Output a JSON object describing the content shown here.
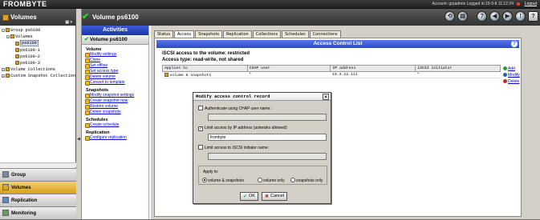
{
  "app": {
    "logo": "FROMBYTE",
    "account_text": "Account: grpadmin   Logged in:15-9-8 11:12:24",
    "logout_label": "Logout"
  },
  "left": {
    "title": "Volumes",
    "toolbar": "▣ ▾",
    "tree": [
      {
        "label": "Group ps6100",
        "level": 0,
        "expander": "−",
        "icon": "group"
      },
      {
        "label": "Volumes",
        "level": 1,
        "expander": "−",
        "icon": "folder"
      },
      {
        "label": "ps6100",
        "level": 2,
        "expander": "",
        "icon": "volume",
        "selected": true
      },
      {
        "label": "ps6100-1",
        "level": 2,
        "expander": "",
        "icon": "volume"
      },
      {
        "label": "ps6100-2",
        "level": 2,
        "expander": "",
        "icon": "volume"
      },
      {
        "label": "ps6100-3",
        "level": 2,
        "expander": "",
        "icon": "volume"
      },
      {
        "label": "Volume Collections",
        "level": 0,
        "expander": "+",
        "icon": "folder"
      },
      {
        "label": "Custom Snapshot Collections",
        "level": 0,
        "expander": "+",
        "icon": "folder"
      }
    ],
    "nav": [
      {
        "label": "Group",
        "active": false,
        "icon_color": "#7a8aa0"
      },
      {
        "label": "Volumes",
        "active": true,
        "icon_color": "#d6a42c"
      },
      {
        "label": "Replication",
        "active": false,
        "icon_color": "#5a8ac0"
      },
      {
        "label": "Monitoring",
        "active": false,
        "icon_color": "#6a9a6a"
      }
    ]
  },
  "main": {
    "title": "Volume ps6100",
    "header_icons": [
      "refresh-icon",
      "print-icon",
      "help-icon-round",
      "back-icon",
      "forward-icon",
      "alert-icon",
      "help-icon"
    ]
  },
  "activities": {
    "title": "Activities",
    "subtitle": "Volume ps6100",
    "sections": [
      {
        "heading": "Volume",
        "links": [
          "Modify settings",
          "Clone",
          "Set offline",
          "Set access type",
          "Delete volume",
          "Convert to template"
        ]
      },
      {
        "heading": "Snapshots",
        "links": [
          "Modify snapshot settings",
          "Create snapshot now",
          "Restore volume",
          "Delete snapshots"
        ]
      },
      {
        "heading": "Schedules",
        "links": [
          "Create schedule"
        ]
      },
      {
        "heading": "Replication",
        "links": [
          "Configure replication"
        ]
      }
    ]
  },
  "tabs": [
    "Status",
    "Access",
    "Snapshots",
    "Replication",
    "Collections",
    "Schedules",
    "Connections"
  ],
  "active_tab": "Access",
  "acl": {
    "title": "Access Control List",
    "help": "?",
    "iscsi_line": "iSCSI access to the volume: restricted",
    "access_type_line": "Access type: read-write, not shared",
    "columns": [
      "Applies to",
      "CHAP user",
      "IP address",
      "iSCSI initiator"
    ],
    "rows": [
      [
        "volume & snapshots",
        "*",
        "10.3.12.111",
        "*"
      ]
    ],
    "side_buttons": [
      {
        "label": "Add",
        "icon": "add-icon",
        "color": "#2aa02a"
      },
      {
        "label": "Modify",
        "icon": "modify-icon",
        "color": "#2a60c0"
      },
      {
        "label": "Delete",
        "icon": "delete-icon",
        "color": "#c02a2a"
      }
    ]
  },
  "dialog": {
    "title": "Modify access control record",
    "close": "×",
    "chap_label": "Authenticate using CHAP user name:",
    "chap_checked": false,
    "chap_value": "",
    "ip_label": "Limit access by IP address (asterisks allowed):",
    "ip_checked": true,
    "ip_value": "frombyte",
    "initiator_label": "Limit access to iSCSI initiator name:",
    "initiator_checked": false,
    "initiator_value": "",
    "apply_label": "Apply to:",
    "apply_options": [
      "volume & snapshots",
      "volume only",
      "snapshots only"
    ],
    "apply_selected": "volume & snapshots",
    "ok_label": "OK",
    "cancel_label": "Cancel"
  }
}
